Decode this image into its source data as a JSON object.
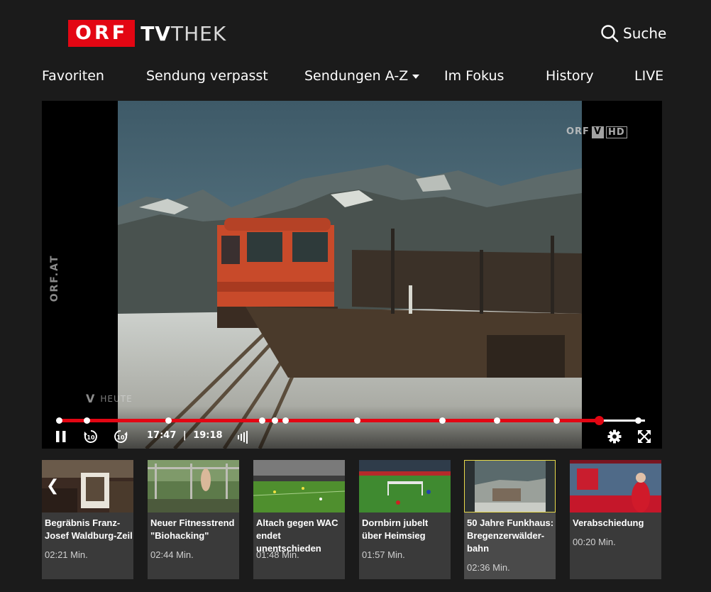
{
  "header": {
    "logo_orf": "ORF",
    "logo_tv": "TV",
    "logo_thek": "THEK",
    "search_label": "Suche"
  },
  "nav": {
    "items": [
      {
        "label": "Favoriten"
      },
      {
        "label": "Sendung verpasst"
      },
      {
        "label": "Sendungen A-Z"
      },
      {
        "label": "Im Fokus"
      },
      {
        "label": "History"
      },
      {
        "label": "LIVE"
      }
    ]
  },
  "player": {
    "side_mark": "ORF.AT",
    "watermark_orf": "ORF",
    "watermark_v": "V",
    "watermark_hd": "HD",
    "bug_v": "V",
    "bug_heute": "HEUTE",
    "current_time": "17:47",
    "duration": "19:18",
    "progress_fraction": 0.921,
    "chapter_fractions": [
      0.0,
      0.047,
      0.187,
      0.346,
      0.368,
      0.386,
      0.509,
      0.654,
      0.747,
      0.849
    ],
    "accent_color": "#e30613"
  },
  "icons": {
    "pause": "pause-icon",
    "rewind": "rewind-10-icon",
    "forward": "forward-10-icon",
    "volume": "volume-icon",
    "settings": "gear-icon",
    "fullscreen": "fullscreen-icon",
    "search": "search-icon",
    "prev": "chevron-left-icon"
  },
  "strip": {
    "prev_glyph": "❮",
    "cards": [
      {
        "title": "Begräbnis Franz-Josef Waldburg-Zeil",
        "duration": "02:21 Min.",
        "active": false
      },
      {
        "title": "Neuer Fitnesstrend \"Biohacking\"",
        "duration": "02:44 Min.",
        "active": false
      },
      {
        "title": "Altach gegen WAC endet unentschieden",
        "duration": "01:48 Min.",
        "active": false
      },
      {
        "title": "Dornbirn jubelt über Heimsieg",
        "duration": "01:57 Min.",
        "active": false
      },
      {
        "title": "50 Jahre Funkhaus: Bregenzerwälder-bahn",
        "duration": "02:36 Min.",
        "active": true
      },
      {
        "title": "Verabschiedung",
        "duration": "00:20 Min.",
        "active": false
      }
    ]
  }
}
